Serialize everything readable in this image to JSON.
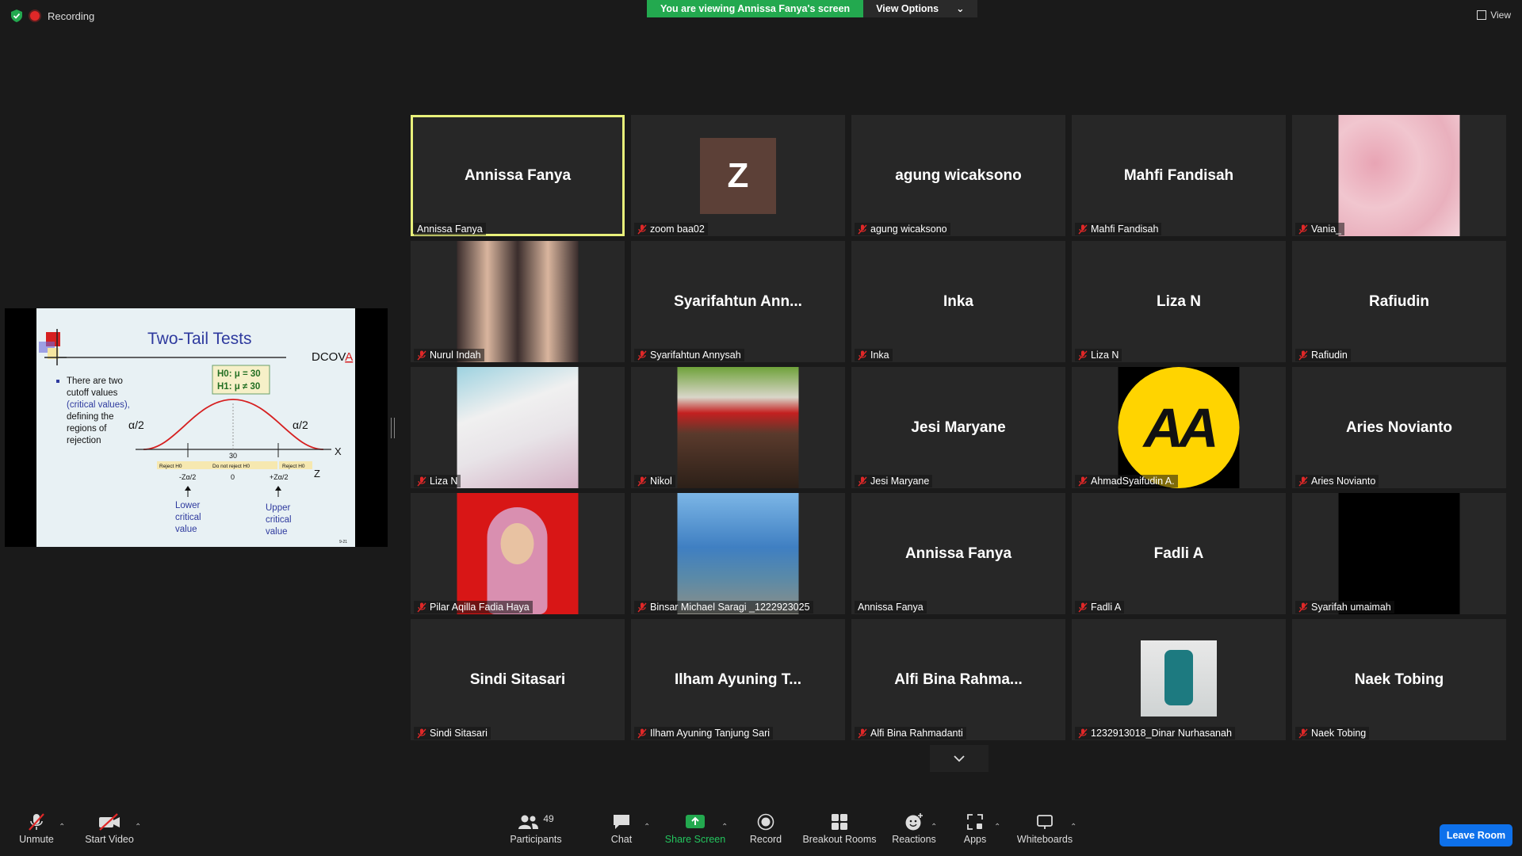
{
  "top": {
    "recording": "Recording",
    "viewing": "You are viewing Annissa Fanya's screen",
    "view_options": "View Options",
    "view": "View"
  },
  "slide": {
    "title": "Two-Tail Tests",
    "brand": "DCOV",
    "brand_last": "A",
    "bullet_1": "There are two",
    "bullet_2": "cutoff values",
    "bullet_3": "(critical values),",
    "bullet_4": "defining the",
    "bullet_5": "regions of",
    "bullet_6": "rejection",
    "h0": "H0: μ = 30",
    "h1": "H1: μ ≠ 30",
    "alpha": "α/2",
    "x": "X",
    "z": "Z",
    "thirty": "30",
    "zero": "0",
    "reject_left": "Reject H0",
    "do_not": "Do not reject H0",
    "reject_right": "Reject H0",
    "neg_z": "-Zα/2",
    "pos_z": "+Zα/2",
    "lower_1": "Lower",
    "lower_2": "critical",
    "lower_3": "value",
    "upper_1": "Upper",
    "upper_2": "critical",
    "upper_3": "value",
    "page": "9-21"
  },
  "tiles": [
    {
      "name": "Annissa Fanya",
      "label": "Annissa Fanya",
      "muted": false
    },
    {
      "name": "",
      "label": "zoom baa02",
      "muted": true,
      "avatar": "Z"
    },
    {
      "name": "agung wicaksono",
      "label": "agung wicaksono",
      "muted": true
    },
    {
      "name": "Mahfi Fandisah",
      "label": "Mahfi Fandisah",
      "muted": true
    },
    {
      "name": "",
      "label": "Vania_",
      "muted": true
    },
    {
      "name": "",
      "label": "Nurul Indah",
      "muted": true
    },
    {
      "name": "Syarifahtun  Ann...",
      "label": "Syarifahtun Annysah",
      "muted": true
    },
    {
      "name": "Inka",
      "label": "Inka",
      "muted": true
    },
    {
      "name": "Liza N",
      "label": "Liza N",
      "muted": true
    },
    {
      "name": "Rafiudin",
      "label": "Rafiudin",
      "muted": true
    },
    {
      "name": "",
      "label": "Liza N",
      "muted": true
    },
    {
      "name": "",
      "label": "Nikol",
      "muted": true
    },
    {
      "name": "Jesi Maryane",
      "label": "Jesi Maryane",
      "muted": true
    },
    {
      "name": "",
      "label": "AhmadSyaifudin A.",
      "muted": true,
      "logo": "AA"
    },
    {
      "name": "Aries Novianto",
      "label": "Aries Novianto",
      "muted": true
    },
    {
      "name": "",
      "label": "Pilar Aqilla Fadia Haya",
      "muted": true
    },
    {
      "name": "",
      "label": "Binsar Michael Saragi _1222923025",
      "muted": true
    },
    {
      "name": "Annissa Fanya",
      "label": "Annissa Fanya",
      "muted": false
    },
    {
      "name": "Fadli A",
      "label": "Fadli A",
      "muted": true
    },
    {
      "name": "",
      "label": "Syarifah umaimah",
      "muted": true
    },
    {
      "name": "Sindi Sitasari",
      "label": "Sindi Sitasari",
      "muted": true
    },
    {
      "name": "Ilham  Ayuning  T...",
      "label": "Ilham Ayuning Tanjung Sari",
      "muted": true
    },
    {
      "name": "Alfi  Bina  Rahma...",
      "label": "Alfi Bina Rahmadanti",
      "muted": true
    },
    {
      "name": "",
      "label": "1232913018_Dinar Nurhasanah",
      "muted": true
    },
    {
      "name": "Naek Tobing",
      "label": "Naek Tobing",
      "muted": true
    }
  ],
  "toolbar": {
    "unmute": "Unmute",
    "start_video": "Start Video",
    "participants": "Participants",
    "participants_count": "49",
    "chat": "Chat",
    "share_screen": "Share Screen",
    "record": "Record",
    "breakout": "Breakout Rooms",
    "reactions": "Reactions",
    "apps": "Apps",
    "whiteboards": "Whiteboards",
    "leave": "Leave Room"
  },
  "colors": {
    "share_green": "#23a94f",
    "leave_blue": "#0e71eb",
    "active_border": "#e8f07a",
    "muted_red": "#e02828"
  }
}
